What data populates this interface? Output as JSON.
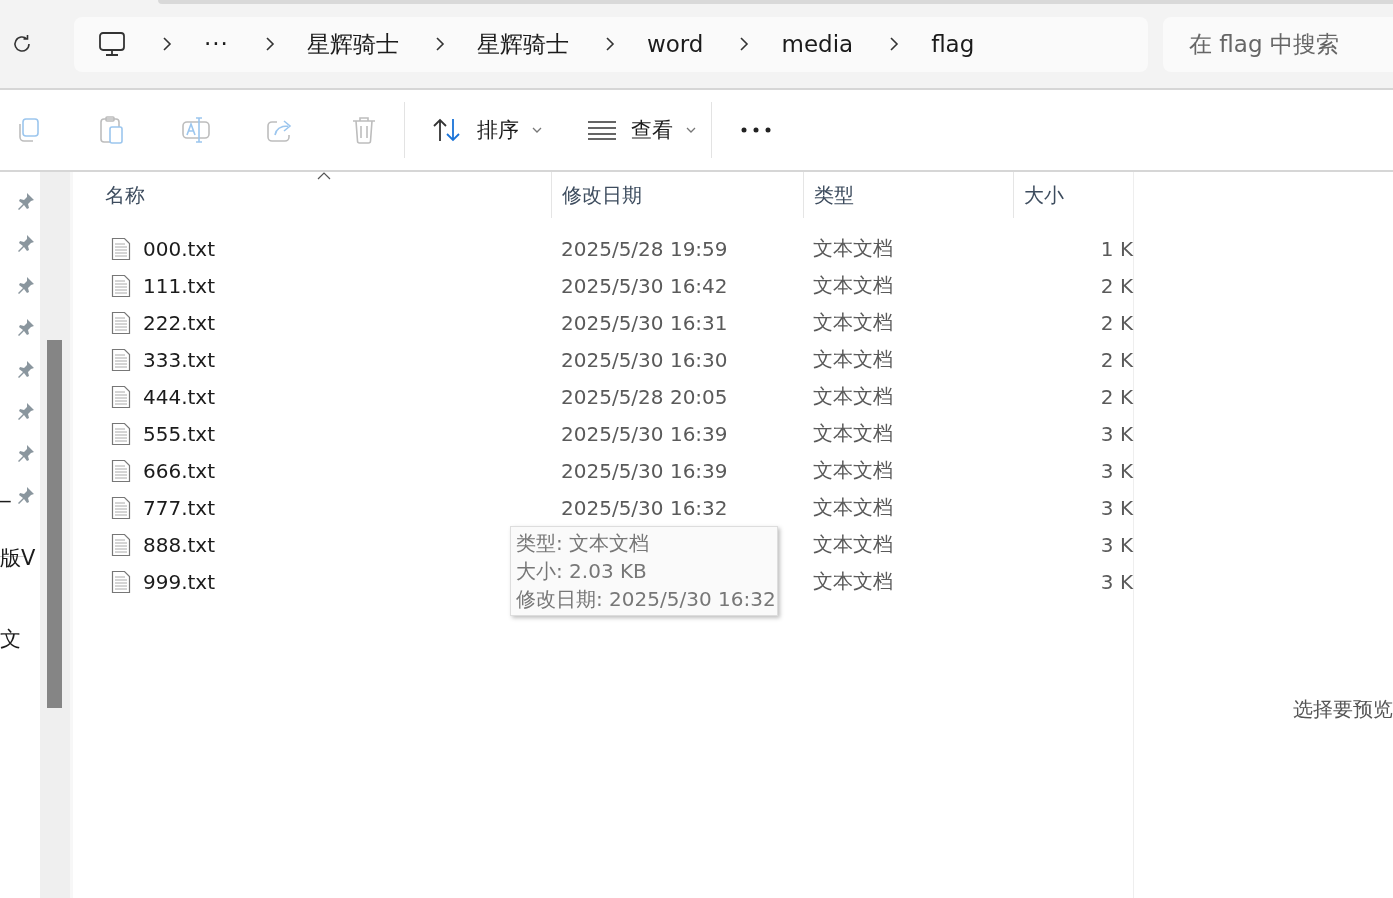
{
  "address_bar": {
    "breadcrumbs": [
      {
        "label": "···",
        "kind": "overflow"
      },
      {
        "label": "星辉骑士",
        "kind": "folder"
      },
      {
        "label": "星辉骑士",
        "kind": "folder"
      },
      {
        "label": "word",
        "kind": "folder"
      },
      {
        "label": "media",
        "kind": "folder"
      },
      {
        "label": "flag",
        "kind": "folder"
      }
    ]
  },
  "search": {
    "placeholder": "在 flag 中搜索"
  },
  "toolbar": {
    "icon_buttons": [
      {
        "kind": "copy",
        "disabled": true
      },
      {
        "kind": "paste",
        "disabled": true
      },
      {
        "kind": "rename",
        "disabled": true
      },
      {
        "kind": "share",
        "disabled": true
      },
      {
        "kind": "delete",
        "disabled": true
      }
    ],
    "menus": [
      {
        "kind": "sort",
        "label": "排序"
      },
      {
        "kind": "view",
        "label": "查看"
      }
    ]
  },
  "sidebar": {
    "items": [
      {
        "pinned": true
      },
      {
        "pinned": true
      },
      {
        "pinned": true
      },
      {
        "pinned": true
      },
      {
        "pinned": true
      },
      {
        "pinned": true
      },
      {
        "pinned": true
      },
      {
        "pinned": true,
        "label": "_"
      },
      {
        "pinned": false,
        "label": "版V"
      },
      {
        "pinned": false,
        "label": "文",
        "kind": "after-divider"
      }
    ]
  },
  "table": {
    "columns": [
      {
        "label": "名称",
        "sorted": true
      },
      {
        "label": "修改日期",
        "sorted": false
      },
      {
        "label": "类型",
        "sorted": false
      },
      {
        "label": "大小",
        "sorted": false
      }
    ],
    "rows": [
      {
        "name": "000.txt",
        "modified": "2025/5/28 19:59",
        "type": "文本文档",
        "size": "1 K"
      },
      {
        "name": "111.txt",
        "modified": "2025/5/30 16:42",
        "type": "文本文档",
        "size": "2 K"
      },
      {
        "name": "222.txt",
        "modified": "2025/5/30 16:31",
        "type": "文本文档",
        "size": "2 K"
      },
      {
        "name": "333.txt",
        "modified": "2025/5/30 16:30",
        "type": "文本文档",
        "size": "2 K"
      },
      {
        "name": "444.txt",
        "modified": "2025/5/28 20:05",
        "type": "文本文档",
        "size": "2 K"
      },
      {
        "name": "555.txt",
        "modified": "2025/5/30 16:39",
        "type": "文本文档",
        "size": "3 K"
      },
      {
        "name": "666.txt",
        "modified": "2025/5/30 16:39",
        "type": "文本文档",
        "size": "3 K"
      },
      {
        "name": "777.txt",
        "modified": "2025/5/30 16:32",
        "type": "文本文档",
        "size": "3 K"
      },
      {
        "name": "888.txt",
        "type": "文本文档",
        "size": "3 K"
      },
      {
        "name": "999.txt",
        "type": "文本文档",
        "size": "3 K"
      }
    ]
  },
  "tooltip": {
    "lines": [
      "类型: 文本文档",
      "大小: 2.03 KB",
      "修改日期: 2025/5/30 16:32"
    ]
  },
  "preview": {
    "message": "选择要预览"
  }
}
